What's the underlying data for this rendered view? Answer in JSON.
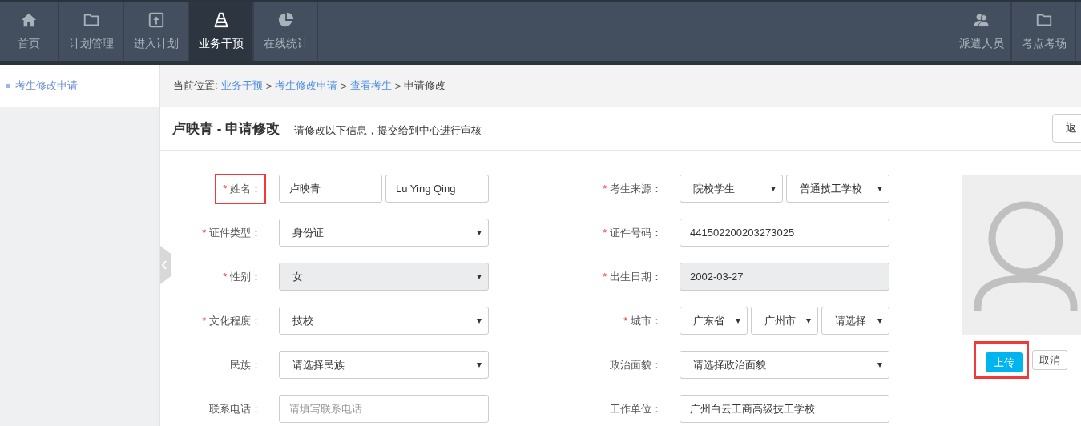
{
  "nav": {
    "items": [
      {
        "label": "首页",
        "kind": "home",
        "selected": false
      },
      {
        "label": "计划管理",
        "kind": "folder",
        "selected": false
      },
      {
        "label": "进入计划",
        "kind": "upload",
        "selected": false
      },
      {
        "label": "业务干预",
        "kind": "cone",
        "selected": true
      },
      {
        "label": "在线统计",
        "kind": "pie",
        "selected": false
      }
    ],
    "right_items": [
      {
        "label": "派遣人员",
        "kind": "people",
        "selected": false
      },
      {
        "label": "考点考场",
        "kind": "folder",
        "selected": false
      }
    ]
  },
  "sidebar": {
    "items": [
      {
        "label": "考生修改申请",
        "selected": true
      }
    ]
  },
  "breadcrumb": {
    "prefix": "当前位置:",
    "separator": ">",
    "links": [
      "业务干预",
      "考生修改申请",
      "查看考生"
    ],
    "current": "申请修改"
  },
  "header": {
    "title": "卢映青 - 申请修改",
    "subtitle": "请修改以下信息，提交给到中心进行审核",
    "back_button": "返"
  },
  "form": {
    "rows": [
      {
        "left": {
          "label": "姓名：",
          "marker": "*",
          "highlighted": true,
          "controls": [
            {
              "kind": "text",
              "value": "卢映青",
              "disabled": false
            },
            {
              "kind": "text",
              "value": "Lu Ying Qing",
              "disabled": false
            }
          ]
        },
        "right": {
          "label": "考生来源：",
          "marker": "*",
          "highlighted": false,
          "controls": [
            {
              "kind": "select",
              "value": "院校学生",
              "disabled": false
            },
            {
              "kind": "select",
              "value": "普通技工学校",
              "disabled": false
            }
          ]
        }
      },
      {
        "left": {
          "label": "证件类型：",
          "marker": "*",
          "highlighted": false,
          "controls": [
            {
              "kind": "select",
              "value": "身份证",
              "disabled": false
            }
          ]
        },
        "right": {
          "label": "证件号码：",
          "marker": "*",
          "highlighted": false,
          "controls": [
            {
              "kind": "text",
              "value": "441502200203273025",
              "disabled": false
            }
          ]
        }
      },
      {
        "left": {
          "label": "性别：",
          "marker": "*",
          "highlighted": false,
          "controls": [
            {
              "kind": "select",
              "value": "女",
              "disabled": true
            }
          ]
        },
        "right": {
          "label": "出生日期：",
          "marker": "*",
          "highlighted": false,
          "controls": [
            {
              "kind": "text",
              "value": "2002-03-27",
              "disabled": true
            }
          ]
        }
      },
      {
        "left": {
          "label": "文化程度：",
          "marker": "*",
          "highlighted": false,
          "controls": [
            {
              "kind": "select",
              "value": "技校",
              "disabled": false
            }
          ]
        },
        "right": {
          "label": "城市：",
          "marker": "*",
          "highlighted": false,
          "controls": [
            {
              "kind": "select",
              "value": "广东省",
              "disabled": false
            },
            {
              "kind": "select",
              "value": "广州市",
              "disabled": false
            },
            {
              "kind": "select",
              "value": "请选择",
              "disabled": false
            }
          ]
        }
      },
      {
        "left": {
          "label": "民族：",
          "highlighted": false,
          "controls": [
            {
              "kind": "select",
              "value": "请选择民族",
              "disabled": false
            }
          ]
        },
        "right": {
          "label": "政治面貌：",
          "highlighted": false,
          "controls": [
            {
              "kind": "select",
              "value": "请选择政治面貌",
              "disabled": false
            }
          ]
        }
      },
      {
        "left": {
          "label": "联系电话：",
          "highlighted": false,
          "controls": [
            {
              "kind": "text",
              "placeholder": "请填写联系电话",
              "disabled": false
            }
          ]
        },
        "right": {
          "label": "工作单位：",
          "highlighted": false,
          "controls": [
            {
              "kind": "text",
              "value": "广州白云工商高级技工学校",
              "disabled": false
            }
          ]
        }
      }
    ]
  },
  "photo": {
    "upload_button": {
      "label": "上传",
      "highlighted": true
    },
    "cancel_button": "取消"
  }
}
